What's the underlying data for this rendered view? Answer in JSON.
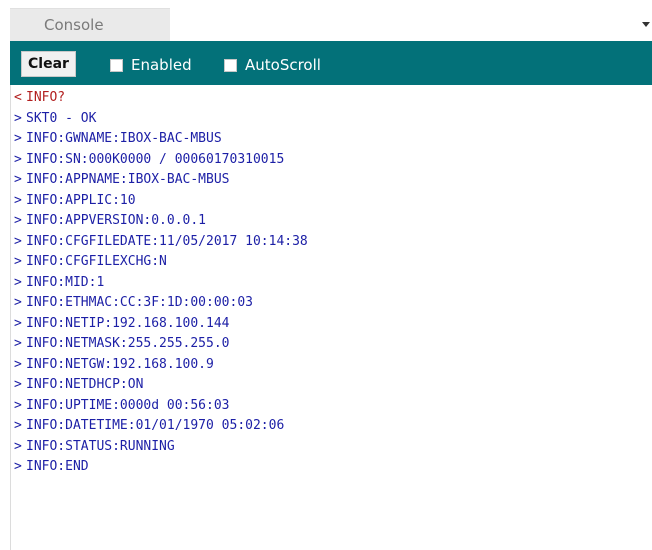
{
  "colors": {
    "toolbar_bg": "#037179",
    "received_text": "#1c1fa6",
    "sent_text": "#b21f1f",
    "tab_bg": "#eaeaea"
  },
  "tab": {
    "label": "Console",
    "dropdown_icon": "chevron-down-icon"
  },
  "toolbar": {
    "clear_label": "Clear",
    "enabled_label": "Enabled",
    "enabled_checked": false,
    "autoscroll_label": "AutoScroll",
    "autoscroll_checked": false
  },
  "console": {
    "lines": [
      {
        "dir": "<",
        "text": "INFO?",
        "kind": "sent"
      },
      {
        "dir": ">",
        "text": "SKT0 - OK",
        "kind": "received"
      },
      {
        "dir": ">",
        "text": "INFO:GWNAME:IBOX-BAC-MBUS",
        "kind": "received"
      },
      {
        "dir": ">",
        "text": "INFO:SN:000K0000 / 00060170310015",
        "kind": "received"
      },
      {
        "dir": ">",
        "text": "INFO:APPNAME:IBOX-BAC-MBUS",
        "kind": "received"
      },
      {
        "dir": ">",
        "text": "INFO:APPLIC:10",
        "kind": "received"
      },
      {
        "dir": ">",
        "text": "INFO:APPVERSION:0.0.0.1",
        "kind": "received"
      },
      {
        "dir": ">",
        "text": "INFO:CFGFILEDATE:11/05/2017 10:14:38",
        "kind": "received"
      },
      {
        "dir": ">",
        "text": "INFO:CFGFILEXCHG:N",
        "kind": "received"
      },
      {
        "dir": ">",
        "text": "INFO:MID:1",
        "kind": "received"
      },
      {
        "dir": ">",
        "text": "INFO:ETHMAC:CC:3F:1D:00:00:03",
        "kind": "received"
      },
      {
        "dir": ">",
        "text": "INFO:NETIP:192.168.100.144",
        "kind": "received"
      },
      {
        "dir": ">",
        "text": "INFO:NETMASK:255.255.255.0",
        "kind": "received"
      },
      {
        "dir": ">",
        "text": "INFO:NETGW:192.168.100.9",
        "kind": "received"
      },
      {
        "dir": ">",
        "text": "INFO:NETDHCP:ON",
        "kind": "received"
      },
      {
        "dir": ">",
        "text": "INFO:UPTIME:0000d 00:56:03",
        "kind": "received"
      },
      {
        "dir": ">",
        "text": "INFO:DATETIME:01/01/1970 05:02:06",
        "kind": "received"
      },
      {
        "dir": ">",
        "text": "INFO:STATUS:RUNNING",
        "kind": "received"
      },
      {
        "dir": ">",
        "text": "INFO:END",
        "kind": "received"
      }
    ]
  }
}
